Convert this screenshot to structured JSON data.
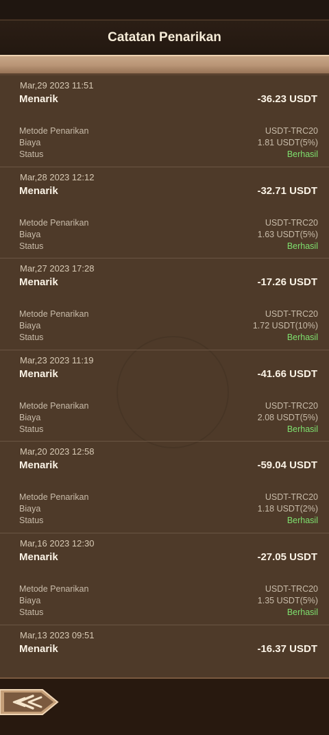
{
  "header": {
    "title": "Catatan Penarikan"
  },
  "labels": {
    "method": "Metode Penarikan",
    "fee": "Biaya",
    "status": "Status"
  },
  "records": [
    {
      "date": "Mar,29 2023 11:51",
      "type": "Menarik",
      "amount": "-36.23 USDT",
      "method": "USDT-TRC20",
      "fee": "1.81 USDT(5%)",
      "status": "Berhasil"
    },
    {
      "date": "Mar,28 2023 12:12",
      "type": "Menarik",
      "amount": "-32.71 USDT",
      "method": "USDT-TRC20",
      "fee": "1.63 USDT(5%)",
      "status": "Berhasil"
    },
    {
      "date": "Mar,27 2023 17:28",
      "type": "Menarik",
      "amount": "-17.26 USDT",
      "method": "USDT-TRC20",
      "fee": "1.72 USDT(10%)",
      "status": "Berhasil"
    },
    {
      "date": "Mar,23 2023 11:19",
      "type": "Menarik",
      "amount": "-41.66 USDT",
      "method": "USDT-TRC20",
      "fee": "2.08 USDT(5%)",
      "status": "Berhasil"
    },
    {
      "date": "Mar,20 2023 12:58",
      "type": "Menarik",
      "amount": "-59.04 USDT",
      "method": "USDT-TRC20",
      "fee": "1.18 USDT(2%)",
      "status": "Berhasil"
    },
    {
      "date": "Mar,16 2023 12:30",
      "type": "Menarik",
      "amount": "-27.05 USDT",
      "method": "USDT-TRC20",
      "fee": "1.35 USDT(5%)",
      "status": "Berhasil"
    },
    {
      "date": "Mar,13 2023 09:51",
      "type": "Menarik",
      "amount": "-16.37 USDT"
    }
  ],
  "colors": {
    "success": "#7ee06e",
    "background": "#4e3a29",
    "header": "#231810",
    "accent_trim": "#b99576"
  },
  "icons": {
    "back": "back-arrow-icon"
  }
}
